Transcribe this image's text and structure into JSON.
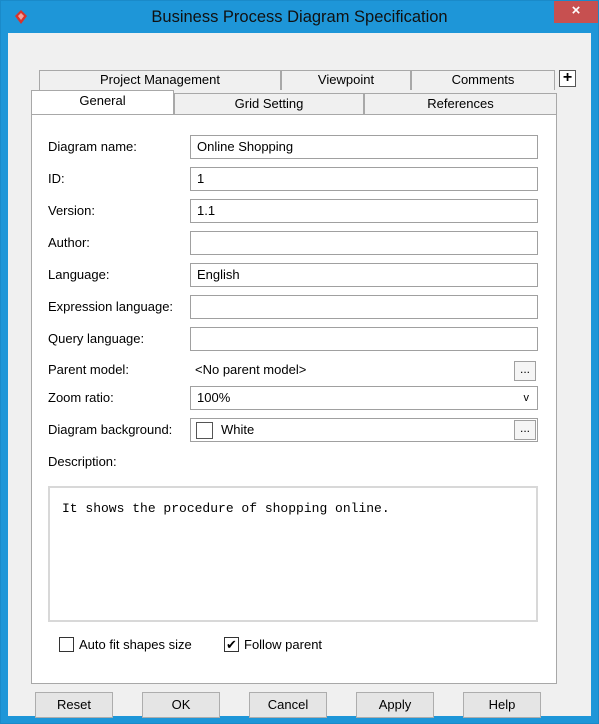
{
  "window": {
    "title": "Business Process Diagram Specification",
    "close_glyph": "×",
    "icon": "diamond-logo-icon"
  },
  "tabs": {
    "row1": [
      "Project Management",
      "Viewpoint",
      "Comments"
    ],
    "row2": [
      "General",
      "Grid Setting",
      "References"
    ],
    "active": "General",
    "add_glyph": "+"
  },
  "form": {
    "diagram_name_label": "Diagram name:",
    "diagram_name_value": "Online Shopping",
    "id_label": "ID:",
    "id_value": "1",
    "version_label": "Version:",
    "version_value": "1.1",
    "author_label": "Author:",
    "author_value": "",
    "language_label": "Language:",
    "language_value": "English",
    "expression_language_label": "Expression language:",
    "expression_language_value": "",
    "query_language_label": "Query language:",
    "query_language_value": "",
    "parent_model_label": "Parent model:",
    "parent_model_value": "<No parent model>",
    "zoom_ratio_label": "Zoom ratio:",
    "zoom_ratio_value": "100%",
    "diagram_background_label": "Diagram background:",
    "diagram_background_value": "White",
    "diagram_background_color": "#ffffff",
    "ellipsis_glyph": "...",
    "dropdown_glyph": "v",
    "description_label": "Description:",
    "description_value": "It shows the procedure of shopping online."
  },
  "options": {
    "auto_fit_label": "Auto fit shapes size",
    "auto_fit_checked": false,
    "follow_parent_label": "Follow parent",
    "follow_parent_checked": true,
    "check_glyph": "✔"
  },
  "buttons": {
    "reset": "Reset",
    "ok": "OK",
    "cancel": "Cancel",
    "apply": "Apply",
    "help": "Help"
  },
  "colors": {
    "title_bar": "#1e96d8",
    "close_button": "#c75050",
    "logo": "#d9332b"
  }
}
